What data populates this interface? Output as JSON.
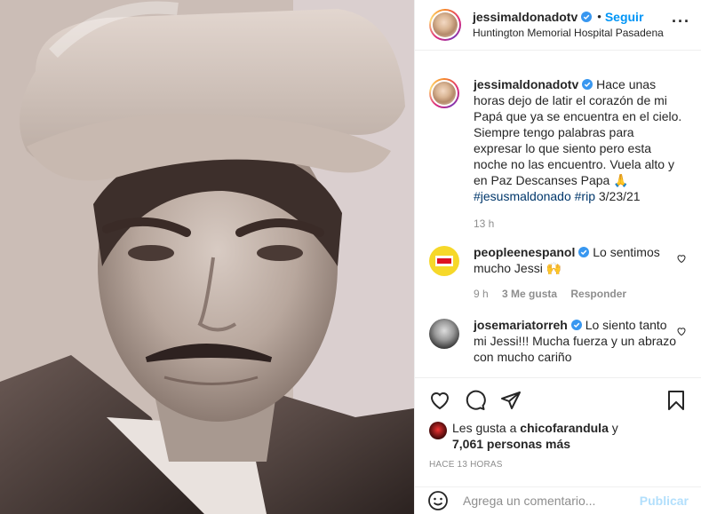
{
  "post": {
    "username": "jessimaldonadotv",
    "follow_label": "Seguir",
    "separator": "•",
    "location": "Huntington Memorial Hospital Pasadena",
    "more_label": "···"
  },
  "caption": {
    "username": "jessimaldonadotv",
    "text": "Hace unas horas dejo de latir el corazón de mi Papá que ya se encuentra en el cielo. Siempre tengo palabras para expresar lo que siento pero esta noche no las encuentro. Vuela alto y en Paz Descanses Papa 🙏",
    "hashtags": "#jesusmaldonado #rip",
    "date": "3/23/21",
    "age": "13 h"
  },
  "comments": [
    {
      "username": "peopleenespanol",
      "text": "Lo sentimos mucho Jessi 🙌",
      "age": "9 h",
      "likes": "3 Me gusta",
      "reply": "Responder"
    },
    {
      "username": "josemariatorreh",
      "text": "Lo siento tanto mi Jessi!!! Mucha fuerza y un abrazo con mucho cariño"
    }
  ],
  "likes": {
    "prefix": "Les gusta a",
    "user": "chicofarandula",
    "conj": "y",
    "others": "7,061 personas más"
  },
  "timestamp": "HACE 13 HORAS",
  "comment_box": {
    "placeholder": "Agrega un comentario...",
    "publish_label": "Publicar"
  },
  "icons": {
    "verified": "verified-badge-icon",
    "like": "heart-icon",
    "comment": "comment-icon",
    "share": "share-icon",
    "save": "bookmark-icon",
    "emoji": "emoji-icon"
  },
  "colors": {
    "link_blue": "#0095f6",
    "verified_blue": "#3897f0",
    "muted": "#8e8e8e",
    "text": "#262626"
  }
}
